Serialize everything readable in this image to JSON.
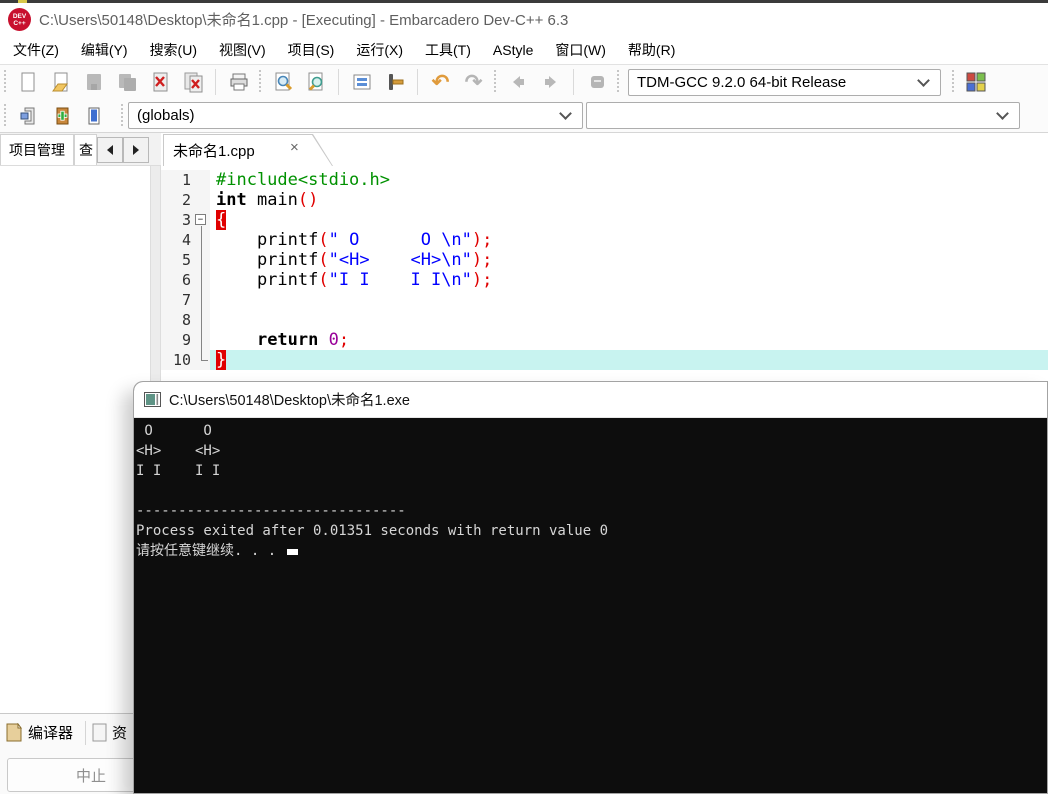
{
  "window": {
    "title": "C:\\Users\\50148\\Desktop\\未命名1.cpp - [Executing] - Embarcadero Dev-C++ 6.3",
    "dev_badge": [
      "DEV",
      "C++"
    ]
  },
  "menu": {
    "items": [
      "文件(Z)",
      "编辑(Y)",
      "搜索(U)",
      "视图(V)",
      "项目(S)",
      "运行(X)",
      "工具(T)",
      "AStyle",
      "窗口(W)",
      "帮助(R)"
    ]
  },
  "toolbar": {
    "compiler_profile": "TDM-GCC 9.2.0 64-bit Release",
    "class_browser": "(globals)",
    "member_browser": ""
  },
  "icons": {
    "undo": "↶",
    "redo": "↷",
    "fold_collapse": "−",
    "close_tab": "×"
  },
  "left_panel": {
    "tabs": [
      "项目管理",
      "查"
    ]
  },
  "editor": {
    "tab": "未命名1.cpp",
    "lines": [
      {
        "n": "1",
        "tokens": [
          {
            "t": "#include<stdio.h>",
            "c": "pp"
          }
        ]
      },
      {
        "n": "2",
        "tokens": [
          {
            "t": "int",
            "c": "kw"
          },
          {
            "t": " main",
            "c": "id"
          },
          {
            "t": "()",
            "c": "sym"
          }
        ]
      },
      {
        "n": "3",
        "fold": "start",
        "tokens": [
          {
            "t": "{",
            "c": "brace"
          }
        ]
      },
      {
        "n": "4",
        "fold": "mid",
        "tokens": [
          {
            "t": "    printf",
            "c": "id"
          },
          {
            "t": "(",
            "c": "sym"
          },
          {
            "t": "\" O      O \\n\"",
            "c": "str"
          },
          {
            "t": ");",
            "c": "sym"
          }
        ]
      },
      {
        "n": "5",
        "fold": "mid",
        "tokens": [
          {
            "t": "    printf",
            "c": "id"
          },
          {
            "t": "(",
            "c": "sym"
          },
          {
            "t": "\"<H>    <H>\\n\"",
            "c": "str"
          },
          {
            "t": ");",
            "c": "sym"
          }
        ]
      },
      {
        "n": "6",
        "fold": "mid",
        "tokens": [
          {
            "t": "    printf",
            "c": "id"
          },
          {
            "t": "(",
            "c": "sym"
          },
          {
            "t": "\"I I    I I\\n\"",
            "c": "str"
          },
          {
            "t": ");",
            "c": "sym"
          }
        ]
      },
      {
        "n": "7",
        "fold": "mid",
        "tokens": []
      },
      {
        "n": "8",
        "fold": "mid",
        "tokens": []
      },
      {
        "n": "9",
        "fold": "mid",
        "tokens": [
          {
            "t": "    ",
            "c": "id"
          },
          {
            "t": "return",
            "c": "kw"
          },
          {
            "t": " ",
            "c": "id"
          },
          {
            "t": "0",
            "c": "num"
          },
          {
            "t": ";",
            "c": "sym"
          }
        ]
      },
      {
        "n": "10",
        "fold": "end",
        "current": true,
        "tokens": [
          {
            "t": "}",
            "c": "brace"
          }
        ]
      }
    ]
  },
  "console": {
    "title": "C:\\Users\\50148\\Desktop\\未命名1.exe",
    "lines": [
      " O      O",
      "<H>    <H>",
      "I I    I I",
      "",
      "--------------------------------",
      "Process exited after 0.01351 seconds with return value 0",
      "请按任意键继续. . . "
    ]
  },
  "bottom": {
    "tabs": [
      "编译器",
      "资"
    ],
    "abort": "中止"
  },
  "colors": {
    "c-pp": "#009100",
    "c-kw": "#000000",
    "c-id": "#000000",
    "c-sym": "#e00000",
    "c-str": "#0000ff",
    "c-num": "#990099",
    "brace-fg": "#ffffff",
    "brace-bg": "#e00000",
    "current-line": "#c8f3f0",
    "console-bg": "#0d0d0d",
    "console-fg": "#d6d6d6",
    "titlebar-text": "#5f5f5f"
  }
}
